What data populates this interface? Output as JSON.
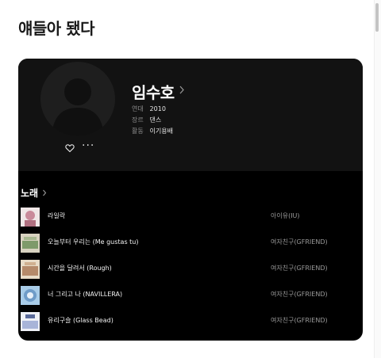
{
  "page": {
    "title": "얘들아 됐다"
  },
  "artist": {
    "name": "임수호",
    "meta": [
      {
        "key": "연대",
        "value": "2010"
      },
      {
        "key": "장르",
        "value": "댄스"
      },
      {
        "key": "활동",
        "value": "이기용배"
      }
    ]
  },
  "actions": {
    "like_icon": "heart-icon",
    "more_label": "···"
  },
  "songs": {
    "heading": "노래",
    "items": [
      {
        "title": "라일락",
        "artist": "아이유(IU)",
        "thumb_color": "#c98a9a"
      },
      {
        "title": "오늘부터 우리는 (Me gustas tu)",
        "artist": "여자친구(GFRIEND)",
        "thumb_color": "#7e9a6a"
      },
      {
        "title": "시간을 달려서 (Rough)",
        "artist": "여자친구(GFRIEND)",
        "thumb_color": "#b58a6a"
      },
      {
        "title": "너 그리고 나 (NAVILLERA)",
        "artist": "여자친구(GFRIEND)",
        "thumb_color": "#6f9cc8"
      },
      {
        "title": "유리구슬 (Glass Bead)",
        "artist": "여자친구(GFRIEND)",
        "thumb_color": "#a8b4d8"
      }
    ]
  }
}
